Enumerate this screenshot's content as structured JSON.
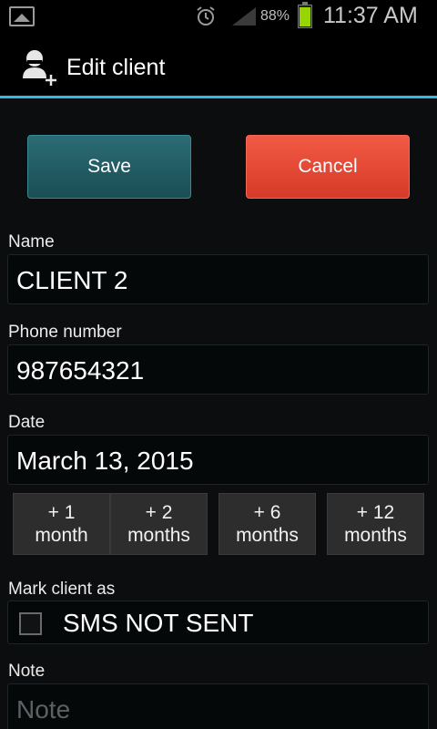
{
  "status_bar": {
    "battery_percent": "88%",
    "time": "11:37 AM",
    "icons": [
      "gallery-icon",
      "alarm-icon",
      "signal-icon",
      "battery-icon"
    ],
    "battery_level": 0.88
  },
  "action_bar": {
    "icon": "add-user-icon",
    "title": "Edit client",
    "accent_color": "#33b5e5"
  },
  "form": {
    "save_label": "Save",
    "cancel_label": "Cancel",
    "name": {
      "label": "Name",
      "value": "CLIENT 2"
    },
    "phone": {
      "label": "Phone number",
      "value": "987654321"
    },
    "date": {
      "label": "Date",
      "value": "March 13, 2015"
    },
    "increments": [
      {
        "top": "+ 1",
        "bottom": "month"
      },
      {
        "top": "+ 2",
        "bottom": "months"
      },
      {
        "top": "+ 6",
        "bottom": "months"
      },
      {
        "top": "+ 12",
        "bottom": "months"
      }
    ],
    "mark_as": {
      "label": "Mark client as",
      "option": "SMS NOT SENT",
      "checked": false
    },
    "note": {
      "label": "Note",
      "placeholder": "Note",
      "value": ""
    }
  },
  "colors": {
    "save": "#1f5a62",
    "cancel": "#e8452f",
    "background": "#0b0d0e"
  }
}
